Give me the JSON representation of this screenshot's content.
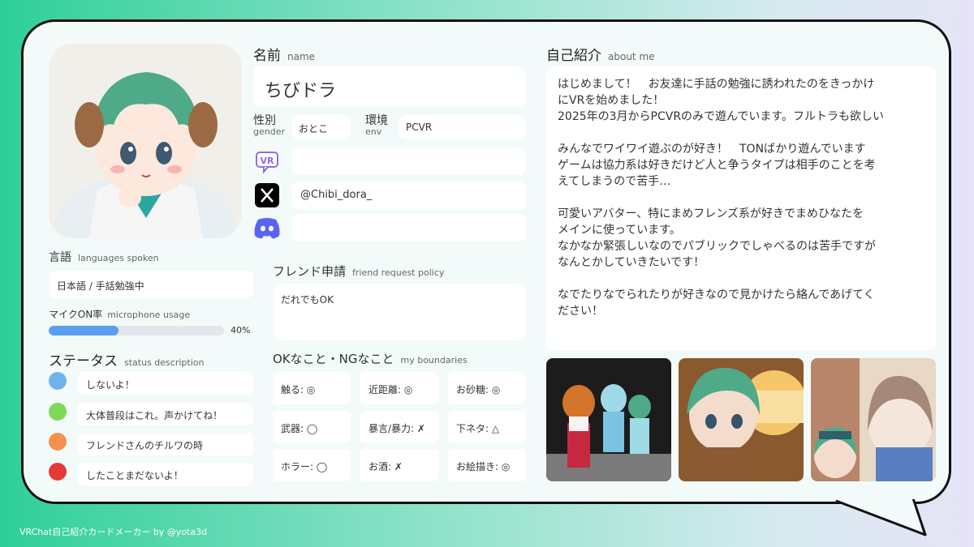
{
  "name": {
    "label_ja": "名前",
    "label_en": "name",
    "value": "ちびドラ"
  },
  "gender": {
    "label_ja": "性別",
    "label_en": "gender",
    "value": "おとこ"
  },
  "env": {
    "label_ja": "環境",
    "label_en": "env",
    "value": "PCVR"
  },
  "socials": {
    "vrchat": "",
    "x": "@Chibi_dora_",
    "discord": ""
  },
  "languages": {
    "label_ja": "言語",
    "label_en": "languages spoken",
    "value": "日本語 / 手話勉強中"
  },
  "mic": {
    "label_ja": "マイクON率",
    "label_en": "microphone usage",
    "value": 0.4,
    "value_text": "40%",
    "color": "#5b9ef0"
  },
  "status": {
    "label_ja": "ステータス",
    "label_en": "status description",
    "items": [
      {
        "text": "しないよ！",
        "color": "#6fb3ec"
      },
      {
        "text": "大体普段はこれ。声かけてね！",
        "color": "#7ed957"
      },
      {
        "text": "フレンドさんのチルワの時",
        "color": "#f4914d"
      },
      {
        "text": "したことまだないよ！",
        "color": "#e53935"
      }
    ]
  },
  "friend": {
    "label_ja": "フレンド申請",
    "label_en": "friend request policy",
    "value": "だれでもOK"
  },
  "boundaries": {
    "label_ja": "OKなこと・NGなこと",
    "label_en": "my boundaries",
    "items": [
      "触る: ◎",
      "近距離: ◎",
      "お砂糖: ◎",
      "武器: ◯",
      "暴言/暴力: ✗",
      "下ネタ: △",
      "ホラー: ◯",
      "お酒: ✗",
      "お絵描き: ◎"
    ]
  },
  "about": {
    "label_ja": "自己紹介",
    "label_en": "about me",
    "lines": [
      "はじめまして！　お友達に手話の勉強に誘われたのをきっかけ",
      "にVRを始めました！",
      "2025年の3月からPCVRのみで遊んでいます。フルトラも欲しい",
      "",
      "みんなでワイワイ遊ぶのが好き！　TONばかり遊んでいます",
      "ゲームは協力系は好きだけど人と争うタイプは相手のことを考",
      "えてしまうので苦手…",
      "",
      "可愛いアバター、特にまめフレンズ系が好きでまめひなたを",
      "メインに使っています。",
      "なかなか緊張しいなのでパブリックでしゃべるのは苦手ですが",
      "なんとかしていきたいです！",
      "",
      "なでたりなでられたりが好きなので見かけたら絡んであげてく",
      "ださい！"
    ]
  },
  "footer": "VRChat自己紹介カードメーカー by @yota3d",
  "icons": {
    "vrchat": "vrchat-icon",
    "x": "x-logo-icon",
    "discord": "discord-icon"
  }
}
